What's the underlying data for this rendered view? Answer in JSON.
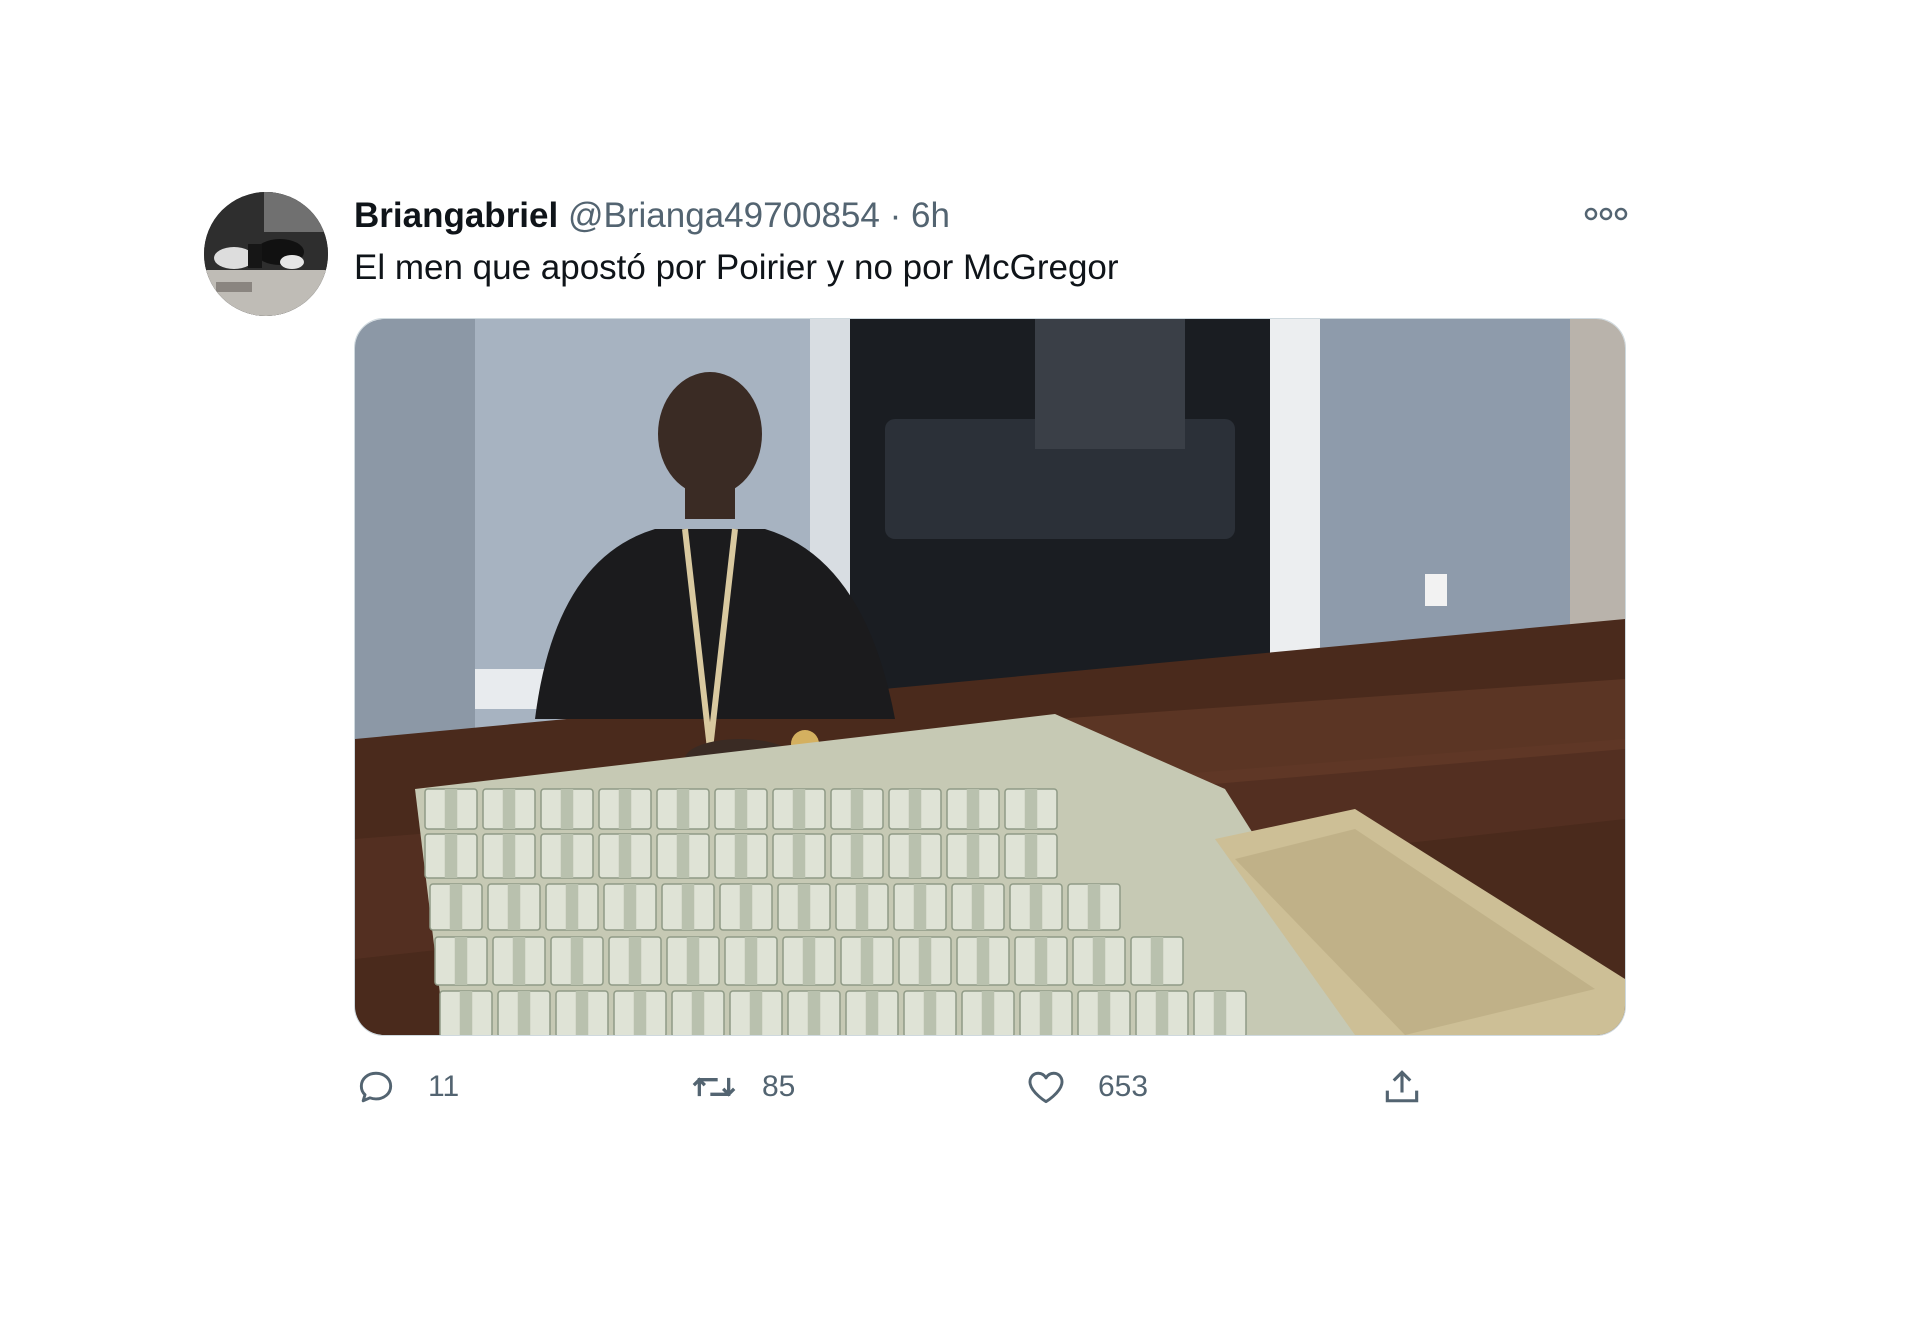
{
  "tweet": {
    "display_name": "Briangabriel",
    "handle": "@Brianga49700854",
    "separator": "·",
    "timestamp": "6h",
    "text": "El men que apostó por Poirier y no por McGregor"
  },
  "icons": {
    "more": "more-horizontal-icon",
    "reply": "reply-bubble-icon",
    "retweet": "retweet-arrows-icon",
    "like": "heart-icon",
    "share": "share-upload-icon"
  },
  "actions": {
    "reply_count": "11",
    "retweet_count": "85",
    "like_count": "653"
  },
  "colors": {
    "text_primary": "#0f1419",
    "text_secondary": "#536471",
    "border": "#cfd9de"
  }
}
